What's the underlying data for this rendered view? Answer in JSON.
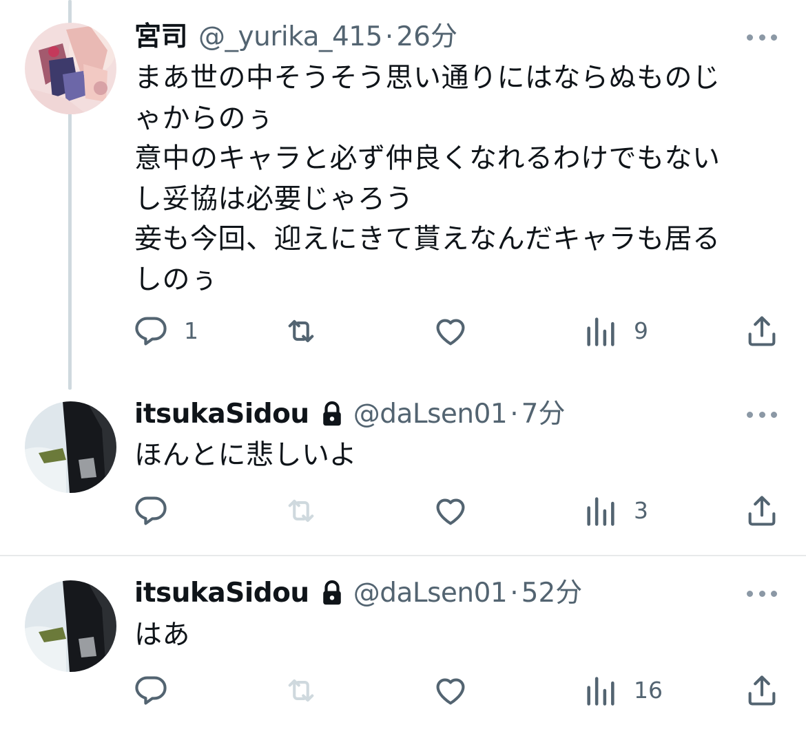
{
  "colors": {
    "text": "#0f1419",
    "secondary": "#536471",
    "thread_line": "#cfd9de",
    "divider": "#e7e9ea",
    "retweet_disabled": "#cfd9de"
  },
  "tweets": [
    {
      "display_name": "宮司",
      "handle": "@_yurika_415",
      "separator": "·",
      "time": "26分",
      "protected": false,
      "lines": [
        "まあ世の中そうそう思い通りにはならぬものじ",
        "ゃからのぅ",
        "意中のキャラと必ず仲良くなれるわけでもない",
        "し妥協は必要じゃろう",
        "妾も今回、迎えにきて貰えなんだキャラも居る",
        "しのぅ"
      ],
      "replies": "1",
      "views": "9",
      "icons": [
        "reply-icon",
        "retweet-icon",
        "like-icon",
        "views-icon",
        "share-icon"
      ]
    },
    {
      "display_name": "itsukaSidou",
      "handle": "@daLsen01",
      "separator": "·",
      "time": "7分",
      "protected": true,
      "lines": [
        "ほんとに悲しいよ"
      ],
      "replies": "",
      "views": "3",
      "icons": [
        "reply-icon",
        "retweet-icon",
        "like-icon",
        "views-icon",
        "share-icon"
      ]
    },
    {
      "display_name": "itsukaSidou",
      "handle": "@daLsen01",
      "separator": "·",
      "time": "52分",
      "protected": true,
      "lines": [
        "はあ"
      ],
      "replies": "",
      "views": "16",
      "icons": [
        "reply-icon",
        "retweet-icon",
        "like-icon",
        "views-icon",
        "share-icon"
      ]
    }
  ]
}
